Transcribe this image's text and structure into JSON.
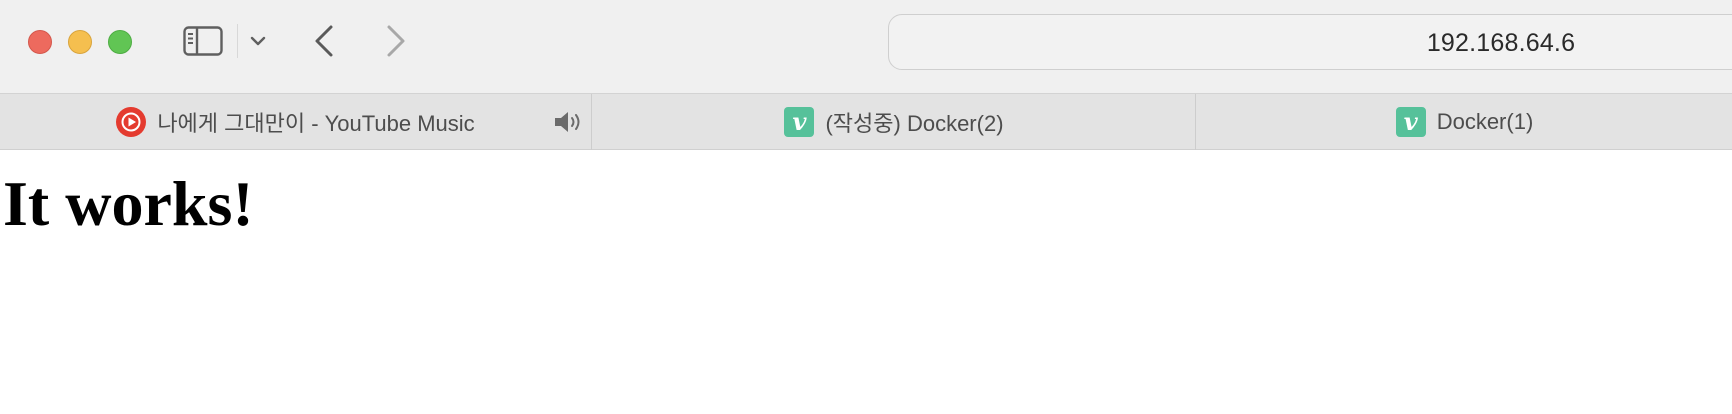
{
  "browser": {
    "address": "192.168.64.6",
    "controls": {
      "close_icon": "close-icon",
      "minimize_icon": "minimize-icon",
      "maximize_icon": "maximize-icon",
      "sidebar_icon": "sidebar-icon",
      "chevron_icon": "chevron-down-icon",
      "back_icon": "back-arrow-icon",
      "forward_icon": "forward-arrow-icon"
    },
    "colors": {
      "close": "#ed6a5e",
      "minimize": "#f5bf4f",
      "maximize": "#61c554",
      "youtube_music": "#e43b2f",
      "velog": "#56c19a"
    }
  },
  "tabs": [
    {
      "title": "나에게 그대만이 - YouTube Music",
      "icon": "youtube-music-icon",
      "audio_icon": "speaker-icon"
    },
    {
      "title": "(작성중) Docker(2)",
      "icon": "v-logo-icon",
      "favicon_letter": "v"
    },
    {
      "title": "Docker(1)",
      "icon": "v-logo-icon",
      "favicon_letter": "v"
    }
  ],
  "page": {
    "heading": "It works!"
  }
}
